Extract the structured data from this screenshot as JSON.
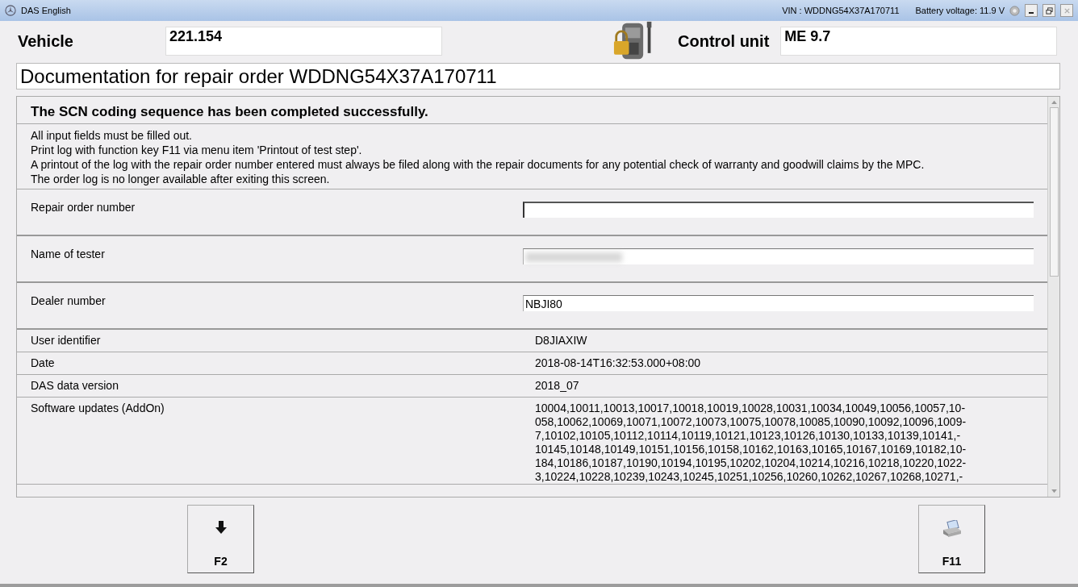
{
  "window": {
    "title": "DAS English",
    "vin": "VIN : WDDNG54X37A170711",
    "battery": "Battery voltage: 11.9 V"
  },
  "header": {
    "vehicle_label": "Vehicle",
    "vehicle_value": "221.154",
    "control_label": "Control unit",
    "control_value": "ME 9.7"
  },
  "document_title": "Documentation for repair order WDDNG54X37A170711",
  "panel": {
    "heading": "The SCN coding sequence has been completed successfully.",
    "notes": [
      "All input fields must be filled out.",
      "Print log with function key F11 via menu item 'Printout of test step'.",
      "A printout of the log with the repair order number entered must always be filed along with the repair documents for any potential check of warranty and goodwill claims by the MPC.",
      "The order log is no longer available after exiting this screen."
    ],
    "inputs": [
      {
        "label": "Repair order number",
        "focused": true,
        "blurred": false
      },
      {
        "label": "Name of tester",
        "focused": false,
        "blurred": true
      },
      {
        "label": "Dealer number",
        "value": "NBJI80",
        "focused": false,
        "blurred": false
      }
    ],
    "info": [
      {
        "label": "User identifier",
        "lines": [
          "D8JIAXIW"
        ]
      },
      {
        "label": "Date",
        "lines": [
          "2018-08-14T16:32:53.000+08:00"
        ]
      },
      {
        "label": "DAS data version",
        "lines": [
          "2018_07"
        ]
      },
      {
        "label": "Software updates (AddOn)",
        "lines": [
          "10004,10011,10013,10017,10018,10019,10028,10031,10034,10049,10056,10057,10-",
          "058,10062,10069,10071,10072,10073,10075,10078,10085,10090,10092,10096,1009-",
          "7,10102,10105,10112,10114,10119,10121,10123,10126,10130,10133,10139,10141,-",
          "10145,10148,10149,10151,10156,10158,10162,10163,10165,10167,10169,10182,10-",
          "184,10186,10187,10190,10194,10195,10202,10204,10214,10216,10218,10220,1022-",
          "3,10224,10228,10239,10243,10245,10251,10256,10260,10262,10267,10268,10271,-"
        ]
      }
    ]
  },
  "buttons": [
    {
      "label": "F2",
      "kind": "down"
    },
    {
      "label": "F11",
      "kind": "print"
    }
  ]
}
